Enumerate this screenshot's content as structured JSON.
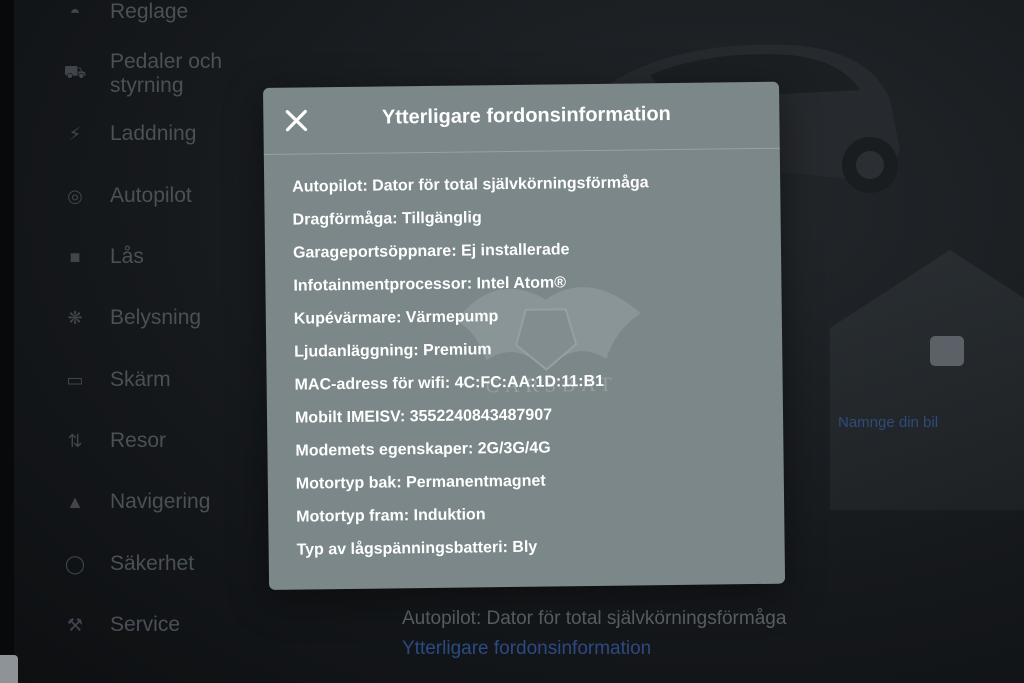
{
  "sidebar": {
    "items": [
      {
        "label": "Reglage",
        "icon": "toggle-icon"
      },
      {
        "label": "Pedaler och styrning",
        "icon": "car-icon"
      },
      {
        "label": "Laddning",
        "icon": "lightning-icon"
      },
      {
        "label": "Autopilot",
        "icon": "steering-wheel-icon"
      },
      {
        "label": "Lås",
        "icon": "lock-icon"
      },
      {
        "label": "Belysning",
        "icon": "lightbulb-icon"
      },
      {
        "label": "Skärm",
        "icon": "display-icon"
      },
      {
        "label": "Resor",
        "icon": "trips-icon"
      },
      {
        "label": "Navigering",
        "icon": "navigation-arrow-icon"
      },
      {
        "label": "Säkerhet",
        "icon": "shield-icon"
      },
      {
        "label": "Service",
        "icon": "wrench-icon"
      }
    ]
  },
  "background": {
    "name_car_link": "Namnge din bil",
    "bottom_info": "Autopilot: Dator för total självkörningsförmåga",
    "bottom_link": "Ytterligare fordonsinformation"
  },
  "modal": {
    "title": "Ytterligare fordonsinformation",
    "close_icon": "close-icon",
    "rows": [
      "Autopilot: Dator för total självkörningsförmåga",
      "Dragförmåga: Tillgänglig",
      "Garageportsöppnare: Ej installerade",
      "Infotainmentprocessor: Intel Atom®",
      "Kupévärmare: Värmepump",
      "Ljudanläggning: Premium",
      "MAC-adress för wifi: 4C:FC:AA:1D:11:B1",
      "Mobilt IMEISV: 3552240843487907",
      "Modemets egenskaper: 2G/3G/4G",
      "Motortyp bak: Permanentmagnet",
      "Motortyp fram: Induktion",
      "Typ av lågspänningsbatteri: Bly"
    ]
  },
  "watermark": {
    "text": "CARSBAT"
  },
  "colors": {
    "modal_bg": "#7b8789",
    "screen_bg": "#15181b",
    "link_blue": "#2c4a82",
    "sidebar_text": "#4a5056"
  }
}
